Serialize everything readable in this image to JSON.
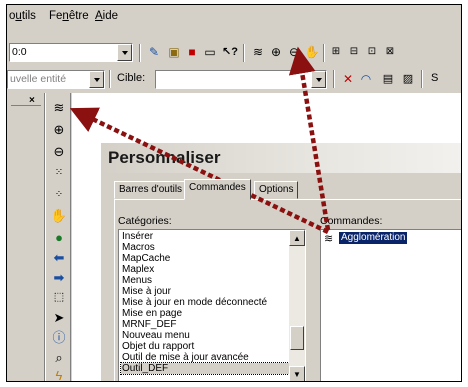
{
  "menubar": {
    "items": [
      {
        "pre": "o",
        "ul": "u",
        "post": "tils"
      },
      {
        "pre": "Fe",
        "ul": "n",
        "post": "être"
      },
      {
        "pre": "",
        "ul": "A",
        "post": "ide"
      }
    ]
  },
  "toolbar1": {
    "scale_value": "0:0"
  },
  "toolbar2": {
    "entity_value": "uvelle entité",
    "cible_label": "Cible:",
    "cible_value": "",
    "trailing_label": "S"
  },
  "panel": {
    "close_glyph": "×"
  },
  "dialog": {
    "title": "Personnaliser",
    "tabs": [
      "Barres d'outils",
      "Commandes",
      "Options"
    ],
    "active_tab": "Commandes",
    "categories_label": "Catégories:",
    "commands_label": "Commandes:",
    "categories": [
      "Insérer",
      "Macros",
      "MapCache",
      "Maplex",
      "Menus",
      "Mise à jour",
      "Mise à jour en mode déconnecté",
      "Mise en page",
      "MRNF_DEF",
      "Nouveau menu",
      "Objet du rapport",
      "Outil de mise à jour avancée",
      "Outil_DEF"
    ],
    "selected_category": "Outil_DEF",
    "commands": [
      "Agglomération"
    ]
  },
  "colors": {
    "arrow": "#8b1010",
    "selection": "#0a246a",
    "face": "#d4d0c8"
  }
}
